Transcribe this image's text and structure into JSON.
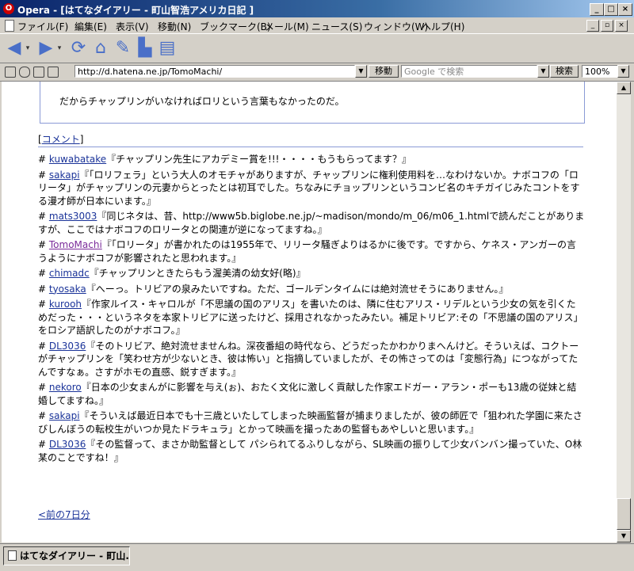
{
  "window": {
    "title": "Opera - [はてなダイアリー - 町山智浩アメリカ日記 ]",
    "logo": "opera-logo",
    "controls": [
      "_",
      "□",
      "×"
    ]
  },
  "menu": {
    "items": [
      "ファイル(F)",
      "編集(E)",
      "表示(V)",
      "移動(N)",
      "ブックマーク(B)",
      "メール(M)",
      "ニュース(S)",
      "ウィンドウ(W)",
      "ヘルプ(H)"
    ],
    "mdi_controls": [
      "_",
      "▫",
      "×"
    ]
  },
  "toolbar": {
    "buttons": [
      "back",
      "forward",
      "reload",
      "home",
      "hotlist",
      "print",
      "save"
    ]
  },
  "address": {
    "url": "http://d.hatena.ne.jp/TomoMachi/",
    "go_label": "移動",
    "search_placeholder": "Google で検索",
    "search_label": "検索",
    "zoom": "100%"
  },
  "page": {
    "quote_text": "だからチャップリンがいなければロリという言葉もなかったのだ。",
    "comment_header": "コメント",
    "comments": [
      {
        "user": "kuwabatake",
        "text": "『チャップリン先生にアカデミー賞を!!!・・・・もうもらってます？』"
      },
      {
        "user": "sakapi",
        "text": "『「ロリフェラ」という大人のオモチャがありますが、チャップリンに権利使用料を…なわけないか。ナボコフの「ロリータ」がチャップリンの元妻からとったとは初耳でした。ちなみにチョップリンというコンビ名のキチガイじみたコントをする漫才師が日本にいます。』"
      },
      {
        "user": "mats3003",
        "text": "『同じネタは、昔、http://www5b.biglobe.ne.jp/~madison/mondo/m_06/m06_1.htmlで読んだことがありますが、ここではナボコフのロリータとの関連が逆になってますね。』"
      },
      {
        "user": "TomoMachi",
        "text": "『「ロリータ」が書かれたのは1955年で、リリータ騒ぎよりはるかに後です。ですから、ケネス・アンガーの言うようにナボコフが影響されたと思われます。』",
        "self": true
      },
      {
        "user": "chimadc",
        "text": "『チャップリンときたらもう渥美清の幼女好(略)』"
      },
      {
        "user": "tyosaka",
        "text": "『へーっ。トリビアの泉みたいですね。ただ、ゴールデンタイムには絶対流せそうにありません。』"
      },
      {
        "user": "kurooh",
        "text": "『作家ルイス・キャロルが「不思議の国のアリス」を書いたのは、隣に住むアリス・リデルという少女の気を引くためだった・・・というネタを本家トリビアに送ったけど、採用されなかったみたい。補足トリビア:その「不思議の国のアリス」をロシア語訳したのがナボコフ。』"
      },
      {
        "user": "DL3036",
        "text": "『そのトリビア、絶対流せませんね。深夜番組の時代なら、どうだったかわかりまへんけど。そういえば、コクトーがチャップリンを「笑わせ方が少ないとき、彼は怖い」と指摘していましたが、その怖さってのは「変態行為」につながってたんですなぁ。さすがホモの直感、鋭すぎます。』"
      },
      {
        "user": "nekoro",
        "text": "『日本の少女まんがに影響を与え(ぉ)、おたく文化に激しく貢献した作家エドガー・アラン・ポーも13歳の従妹と結婚してますね。』"
      },
      {
        "user": "sakapi",
        "text": "『そういえば最近日本でも十三歳といたしてしまった映画監督が捕まりましたが、彼の師匠で「狙われた学園に来たさびしんぼうの転校生がいつか見たドラキュラ」とかって映画を撮ったあの監督もあやしいと思います。』"
      },
      {
        "user": "DL3036",
        "text": "『その監督って、まさか助監督として パシられてるふりしながら、SL映画の振りして少女バンバン撮っていた、O林某のことですね！』"
      }
    ],
    "prev_link": "<前の7日分"
  },
  "tabs": [
    {
      "label": "はてなダイアリー - 町山..."
    }
  ]
}
